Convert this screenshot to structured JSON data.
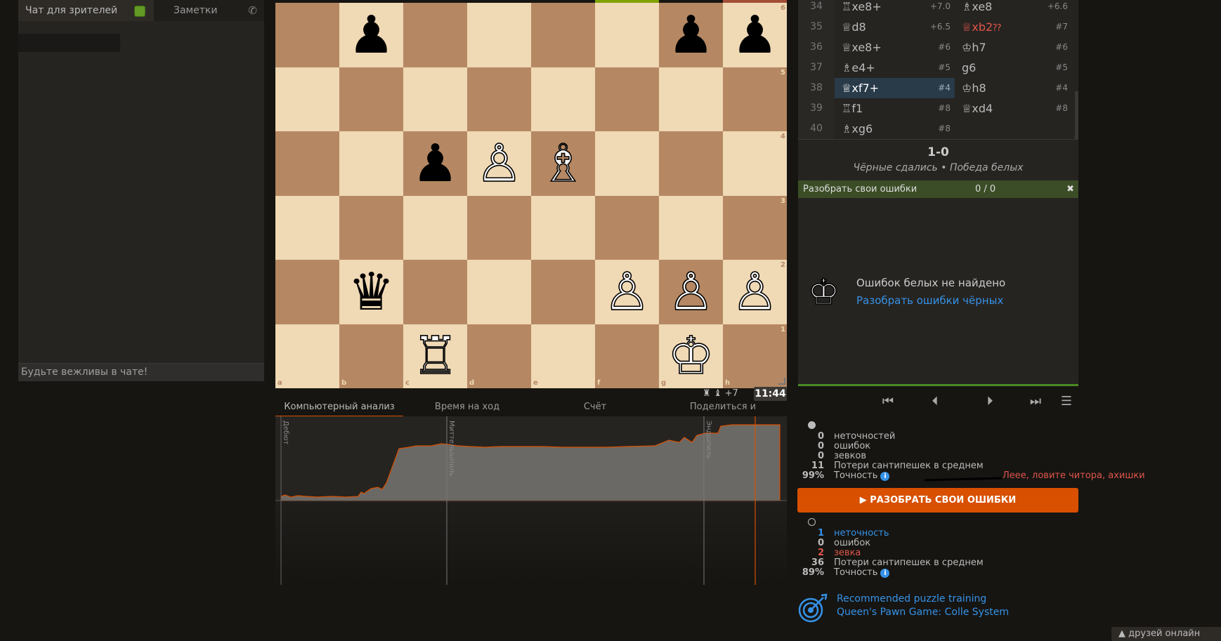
{
  "chat": {
    "tab_chat": "Чат для зрителей",
    "tab_notes": "Заметки",
    "placeholder": "Будьте вежливы в чате!"
  },
  "board": {
    "files": [
      "a",
      "b",
      "c",
      "d",
      "e",
      "f",
      "g",
      "h"
    ],
    "ranks": [
      "6",
      "5",
      "4",
      "3",
      "2",
      "1"
    ],
    "pieces": [
      {
        "sq": "b6",
        "glyph": "♟",
        "color": "black",
        "name": "black-pawn"
      },
      {
        "sq": "g6",
        "glyph": "♟",
        "color": "black",
        "name": "black-pawn"
      },
      {
        "sq": "h6",
        "glyph": "♟",
        "color": "black",
        "name": "black-pawn"
      },
      {
        "sq": "c4",
        "glyph": "♟",
        "color": "black",
        "name": "black-pawn"
      },
      {
        "sq": "d4",
        "glyph": "♙",
        "color": "white",
        "name": "white-pawn"
      },
      {
        "sq": "e4",
        "glyph": "♗",
        "color": "white",
        "name": "white-bishop"
      },
      {
        "sq": "b2",
        "glyph": "♛",
        "color": "black",
        "name": "black-queen"
      },
      {
        "sq": "f2",
        "glyph": "♙",
        "color": "white",
        "name": "white-pawn"
      },
      {
        "sq": "g2",
        "glyph": "♙",
        "color": "white",
        "name": "white-pawn"
      },
      {
        "sq": "h2",
        "glyph": "♙",
        "color": "white",
        "name": "white-pawn"
      },
      {
        "sq": "c1",
        "glyph": "♖",
        "color": "white",
        "name": "white-rook"
      },
      {
        "sq": "g1",
        "glyph": "♔",
        "color": "white",
        "name": "white-king"
      }
    ]
  },
  "material": {
    "text": "♜ ♝ +7"
  },
  "clock": {
    "time": "11:44"
  },
  "analysis_tabs": [
    "Компьютерный анализ",
    "Время на ход",
    "Счёт",
    "Поделиться и экспортировать"
  ],
  "phases": {
    "opening": "Дебют",
    "middlegame": "Миттельшпиль",
    "endgame": "Эндшпиль"
  },
  "moves": [
    {
      "num": "34",
      "white": "♖xe8+",
      "white_eval": "+7.0",
      "black": "♗xe8",
      "black_eval": "+6.6"
    },
    {
      "num": "35",
      "white": "♕d8",
      "white_eval": "+6.5",
      "black": "♕xb2",
      "black_glyph": "⁇",
      "black_eval": "#7",
      "black_blunder": true
    },
    {
      "num": "36",
      "white": "♕xe8+",
      "white_eval": "#6",
      "black": "♔h7",
      "black_eval": "#6"
    },
    {
      "num": "37",
      "white": "♗e4+",
      "white_eval": "#5",
      "black": "g6",
      "black_eval": "#5"
    },
    {
      "num": "38",
      "white": "♕xf7+",
      "white_eval": "#4",
      "black": "♔h8",
      "black_eval": "#4",
      "white_active": true
    },
    {
      "num": "39",
      "white": "♖f1",
      "white_eval": "#8",
      "black": "♕xd4",
      "black_eval": "#8"
    },
    {
      "num": "40",
      "white": "♗xg6",
      "white_eval": "#8",
      "black": "",
      "black_eval": ""
    }
  ],
  "result": {
    "score": "1-0",
    "status": "Чёрные сдались • Победа белых"
  },
  "learn": {
    "bar_label": "Разобрать свои ошибки",
    "count": "0 / 0",
    "close": "✖",
    "message": "Ошибок белых не найдено",
    "link": "Разобрать ошибки чёрных",
    "button": "▶ РАЗОБРАТЬ СВОИ ОШИБКИ"
  },
  "white_stats": {
    "inaccuracies": {
      "n": "0",
      "label": "неточностей"
    },
    "mistakes": {
      "n": "0",
      "label": "ошибок"
    },
    "blunders": {
      "n": "0",
      "label": "зевков"
    },
    "acpl": {
      "n": "11",
      "label": "Потери сантипешек в среднем"
    },
    "accuracy": {
      "n": "99%",
      "label": "Точность"
    }
  },
  "black_stats": {
    "inaccuracies": {
      "n": "1",
      "label": "неточность"
    },
    "mistakes": {
      "n": "0",
      "label": "ошибок"
    },
    "blunders": {
      "n": "2",
      "label": "зевка"
    },
    "acpl": {
      "n": "36",
      "label": "Потери сантипешек в среднем"
    },
    "accuracy": {
      "n": "89%",
      "label": "Точность"
    }
  },
  "annotation": "Леее, ловите читора, ахишки",
  "puzzle": {
    "line1": "Recommended puzzle training",
    "line2": "Queen's Pawn Game: Colle System"
  },
  "friends": "▲ друзей онлайн",
  "colors": {
    "accent": "#d85000",
    "link": "#3692e7",
    "blunder": "#e0554a",
    "learn_bar": "#3b4d26"
  }
}
